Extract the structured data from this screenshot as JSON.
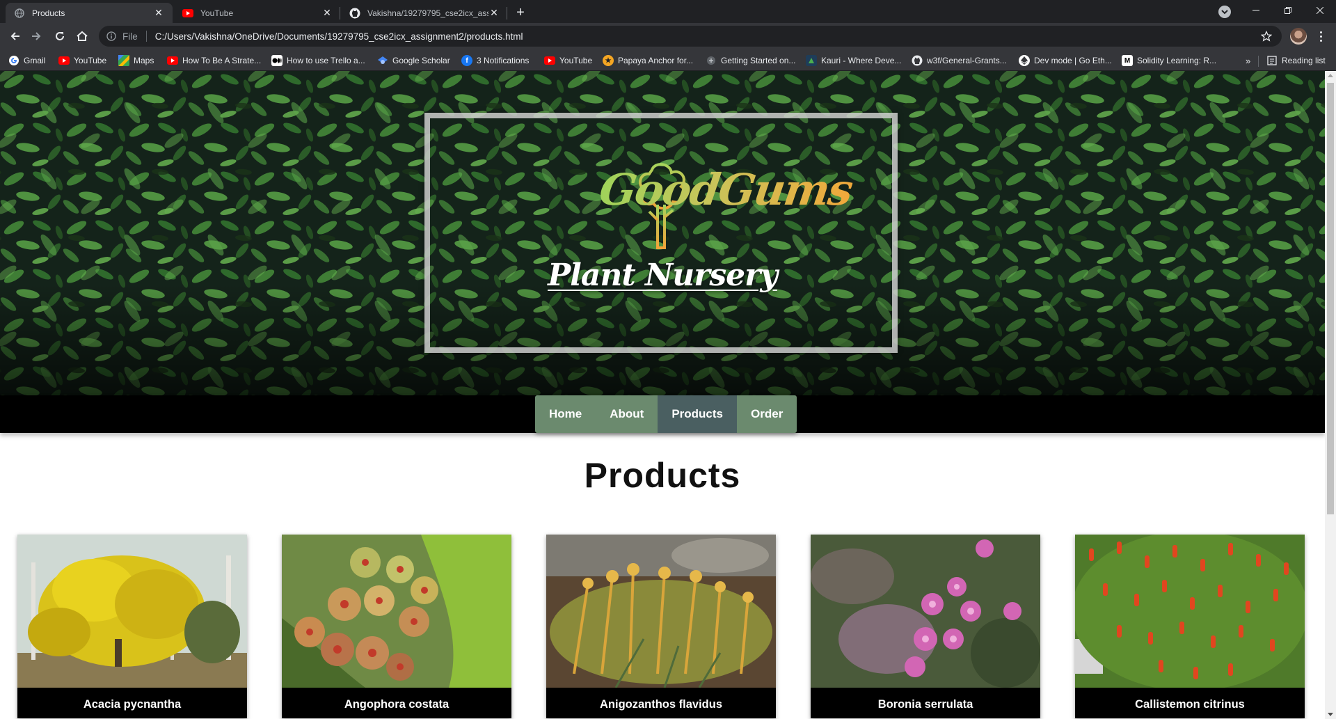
{
  "browser": {
    "tabs": [
      {
        "title": "Products",
        "icon": "globe-icon",
        "active": true
      },
      {
        "title": "YouTube",
        "icon": "youtube-icon",
        "active": false
      },
      {
        "title": "Vakishna/19279795_cse2icx_assig",
        "icon": "github-icon",
        "active": false
      }
    ],
    "address": {
      "scheme": "File",
      "url": "C:/Users/Vakishna/OneDrive/Documents/19279795_cse2icx_assignment2/products.html"
    },
    "bookmarks": [
      {
        "label": "Gmail",
        "icon": "google-icon",
        "color": "#ffffff"
      },
      {
        "label": "YouTube",
        "icon": "youtube-icon",
        "color": "#ff0000"
      },
      {
        "label": "Maps",
        "icon": "maps-icon",
        "color": "#34a853"
      },
      {
        "label": "How To Be A Strate...",
        "icon": "youtube-icon",
        "color": "#ff0000"
      },
      {
        "label": "How to use Trello a...",
        "icon": "medium-icon",
        "color": "#ffffff"
      },
      {
        "label": "Google Scholar",
        "icon": "scholar-icon",
        "color": "#4285f4"
      },
      {
        "label": "3 Notifications",
        "icon": "facebook-icon",
        "color": "#1877f2"
      },
      {
        "label": "YouTube",
        "icon": "youtube-icon",
        "color": "#ff0000"
      },
      {
        "label": "Papaya Anchor for...",
        "icon": "papaya-icon",
        "color": "#f5a623"
      },
      {
        "label": "Getting Started on...",
        "icon": "doc-icon",
        "color": "#9aa0a6"
      },
      {
        "label": "Kauri - Where Deve...",
        "icon": "kauri-icon",
        "color": "#4caf50"
      },
      {
        "label": "w3f/General-Grants...",
        "icon": "github-icon",
        "color": "#ffffff"
      },
      {
        "label": "Dev mode | Go Eth...",
        "icon": "ethereum-icon",
        "color": "#ffffff"
      },
      {
        "label": "Solidity Learning: R...",
        "icon": "medium-icon",
        "color": "#ffffff"
      }
    ],
    "bookmarks_overflow": "»",
    "reading_list": "Reading list"
  },
  "hero": {
    "brand": "GoodGums",
    "tagline": "Plant Nursery"
  },
  "nav": {
    "items": [
      {
        "label": "Home",
        "current": false
      },
      {
        "label": "About",
        "current": false
      },
      {
        "label": "Products",
        "current": true
      },
      {
        "label": "Order",
        "current": false
      }
    ]
  },
  "products": {
    "title": "Products",
    "items": [
      {
        "name": "Acacia pycnantha"
      },
      {
        "name": "Angophora costata"
      },
      {
        "name": "Anigozanthos flavidus"
      },
      {
        "name": "Boronia serrulata"
      },
      {
        "name": "Callistemon citrinus"
      }
    ]
  },
  "colors": {
    "nav_bg": "#6b8a6e",
    "nav_active": "#4a5f61",
    "brand_gradient_start": "#9fd35a",
    "brand_gradient_end": "#f1a83b"
  }
}
